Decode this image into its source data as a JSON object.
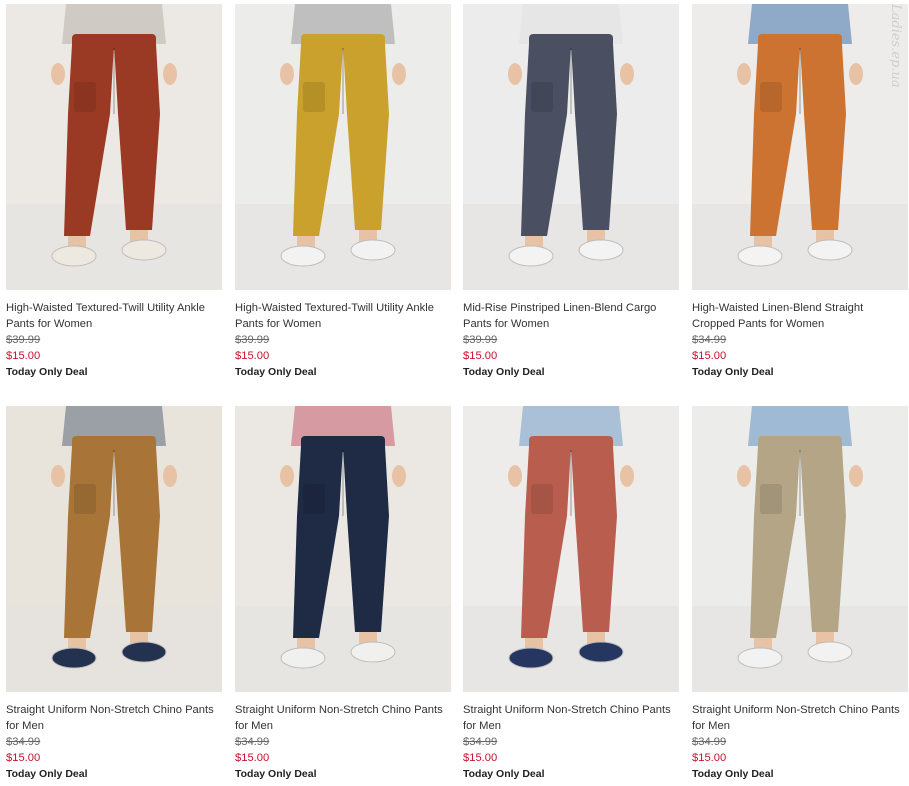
{
  "watermark": "Ladies.ep.ua",
  "products": [
    {
      "title": "High-Waisted Textured-Twill Utility Ankle Pants for Women",
      "was_price": "$39.99",
      "price": "$15.00",
      "badge": "Today Only Deal",
      "pant_color": "#9b3a24",
      "bg_color": "#ece8e4",
      "shoe_color": "#ede8e0",
      "top_color": "#cfcac4"
    },
    {
      "title": "High-Waisted Textured-Twill Utility Ankle Pants for Women",
      "was_price": "$39.99",
      "price": "$15.00",
      "badge": "Today Only Deal",
      "pant_color": "#c9a12c",
      "bg_color": "#ececea",
      "shoe_color": "#f2f2f2",
      "top_color": "#bfbfbf"
    },
    {
      "title": "Mid-Rise Pinstriped Linen-Blend Cargo Pants for Women",
      "was_price": "$39.99",
      "price": "$15.00",
      "badge": "Today Only Deal",
      "pant_color": "#4a5061",
      "bg_color": "#ececec",
      "shoe_color": "#f3f3f3",
      "top_color": "#e6e6e6"
    },
    {
      "title": "High-Waisted Linen-Blend Straight Cropped Pants for Women",
      "was_price": "$34.99",
      "price": "$15.00",
      "badge": "Today Only Deal",
      "pant_color": "#cc7331",
      "bg_color": "#eeeceb",
      "shoe_color": "#f3f3f3",
      "top_color": "#8fa9c9"
    },
    {
      "title": "Straight Uniform Non-Stretch Chino Pants for Men",
      "was_price": "$34.99",
      "price": "$15.00",
      "badge": "Today Only Deal",
      "pant_color": "#a87438",
      "bg_color": "#e9e4db",
      "shoe_color": "#22324f",
      "top_color": "#9aa0a6"
    },
    {
      "title": "Straight Uniform Non-Stretch Chino Pants for Men",
      "was_price": "$34.99",
      "price": "$15.00",
      "badge": "Today Only Deal",
      "pant_color": "#1f2a44",
      "bg_color": "#ebe8e3",
      "shoe_color": "#f0f0ee",
      "top_color": "#d69aa2"
    },
    {
      "title": "Straight Uniform Non-Stretch Chino Pants for Men",
      "was_price": "$34.99",
      "price": "$15.00",
      "badge": "Today Only Deal",
      "pant_color": "#b95e4f",
      "bg_color": "#eeecea",
      "shoe_color": "#253760",
      "top_color": "#a9c0d6"
    },
    {
      "title": "Straight Uniform Non-Stretch Chino Pants for Men",
      "was_price": "$34.99",
      "price": "$15.00",
      "badge": "Today Only Deal",
      "pant_color": "#b5a587",
      "bg_color": "#ececea",
      "shoe_color": "#f2f2f2",
      "top_color": "#9fbad4"
    }
  ]
}
